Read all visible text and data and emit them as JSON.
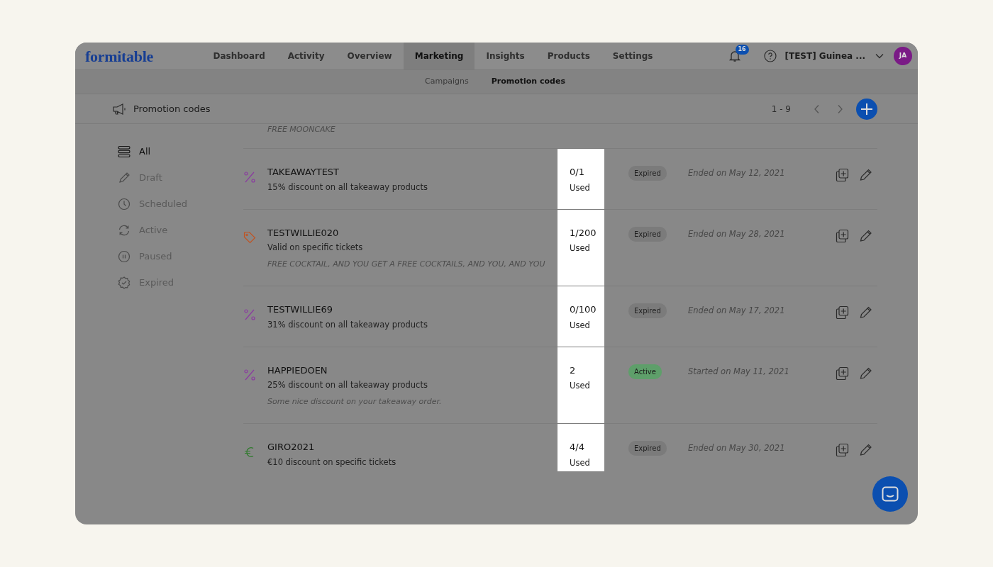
{
  "logo": "formitable",
  "nav": [
    {
      "label": "Dashboard",
      "selected": false
    },
    {
      "label": "Activity",
      "selected": false
    },
    {
      "label": "Overview",
      "selected": false
    },
    {
      "label": "Marketing",
      "selected": true
    },
    {
      "label": "Insights",
      "selected": false
    },
    {
      "label": "Products",
      "selected": false
    },
    {
      "label": "Settings",
      "selected": false
    }
  ],
  "notifications": {
    "count": "16"
  },
  "account": {
    "name": "[TEST] Guinea ...",
    "initials": "JA"
  },
  "subnav": [
    {
      "label": "Campaigns",
      "selected": false
    },
    {
      "label": "Promotion codes",
      "selected": true
    }
  ],
  "header": {
    "title": "Promotion codes",
    "range": "1 - 9"
  },
  "filters": [
    {
      "label": "All",
      "kind": "all",
      "selected": true
    },
    {
      "label": "Draft",
      "kind": "draft",
      "selected": false
    },
    {
      "label": "Scheduled",
      "kind": "scheduled",
      "selected": false
    },
    {
      "label": "Active",
      "kind": "active",
      "selected": false
    },
    {
      "label": "Paused",
      "kind": "paused",
      "selected": false
    },
    {
      "label": "Expired",
      "kind": "expired",
      "selected": false
    }
  ],
  "partial_row": {
    "note": "FREE MOONCAKE"
  },
  "codes": [
    {
      "kind": "percent",
      "name": "TAKEAWAYTEST",
      "description": "15% discount on all takeaway products",
      "used": "0/1",
      "used_label": "Used",
      "status": {
        "label": "Expired",
        "kind": "expired"
      },
      "date": "Ended on May 12, 2021"
    },
    {
      "kind": "tag",
      "name": "TESTWILLIE020",
      "description": "Valid on specific tickets",
      "note": "FREE COCKTAIL, AND YOU GET A FREE COCKTAILS, AND YOU, AND YOU",
      "used": "1/200",
      "used_label": "Used",
      "status": {
        "label": "Expired",
        "kind": "expired"
      },
      "date": "Ended on May 28, 2021"
    },
    {
      "kind": "percent",
      "name": "TESTWILLIE69",
      "description": "31% discount on all takeaway products",
      "used": "0/100",
      "used_label": "Used",
      "status": {
        "label": "Expired",
        "kind": "expired"
      },
      "date": "Ended on May 17, 2021"
    },
    {
      "kind": "percent",
      "name": "HAPPIEDOEN",
      "description": "25% discount on all takeaway products",
      "note": "Some nice discount on your takeaway order.",
      "used": "2",
      "used_label": "Used",
      "status": {
        "label": "Active",
        "kind": "active"
      },
      "date": "Started on May 11, 2021"
    },
    {
      "kind": "euro",
      "name": "GIRO2021",
      "description": "€10 discount on specific tickets",
      "used": "4/4",
      "used_label": "Used",
      "status": {
        "label": "Expired",
        "kind": "expired"
      },
      "date": "Ended on May 30, 2021"
    }
  ]
}
